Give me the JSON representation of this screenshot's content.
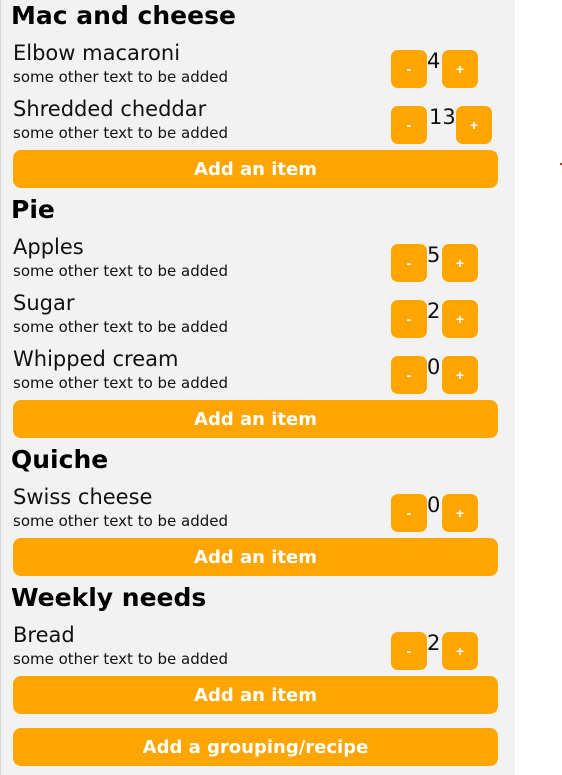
{
  "groups": [
    {
      "title": "Mac and cheese",
      "items": [
        {
          "name": "Elbow macaroni",
          "sub": "some other text to be added",
          "qty": "4"
        },
        {
          "name": "Shredded cheddar",
          "sub": "some other text to be added",
          "qty": "13"
        }
      ]
    },
    {
      "title": "Pie",
      "items": [
        {
          "name": "Apples",
          "sub": "some other text to be added",
          "qty": "5"
        },
        {
          "name": "Sugar",
          "sub": "some other text to be added",
          "qty": "2"
        },
        {
          "name": "Whipped cream",
          "sub": "some other text to be added",
          "qty": "0"
        }
      ]
    },
    {
      "title": "Quiche",
      "items": [
        {
          "name": "Swiss cheese",
          "sub": "some other text to be added",
          "qty": "0"
        }
      ]
    },
    {
      "title": "Weekly needs",
      "items": [
        {
          "name": "Bread",
          "sub": "some other text to be added",
          "qty": "2"
        }
      ]
    }
  ],
  "labels": {
    "minus": "-",
    "plus": "+",
    "add_item": "Add an item",
    "add_group": "Add a grouping/recipe"
  },
  "colors": {
    "accent": "#ffa500",
    "panel_bg": "#f2f2f2"
  }
}
